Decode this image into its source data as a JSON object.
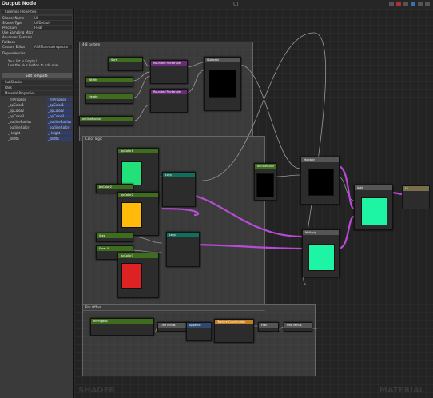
{
  "window": {
    "title": "Output Node",
    "canvas_title": "UI"
  },
  "left_panel": {
    "common_properties_header": "Common Properties",
    "rows": [
      {
        "label": "Shader Name",
        "value": "UI"
      },
      {
        "label": "Shader Type",
        "value": "UI/Default"
      },
      {
        "label": "Precision",
        "value": "Float"
      },
      {
        "label": "Use Sampling Macr",
        "value": ""
      },
      {
        "label": "Advanced Formats",
        "value": ""
      },
      {
        "label": "Fallback",
        "value": ""
      },
      {
        "label": "Custom Editor",
        "value": "ASEMaterialInspector"
      }
    ],
    "dependencies_label": "Dependencies",
    "info_line1": "Your list is Empty!",
    "info_line2": "Use the plus button to add one.",
    "edit_template_label": "Edit Template",
    "sections": [
      "SubShader",
      "Pass",
      "Material Properties"
    ],
    "material_properties": [
      {
        "name": "_fillProgess",
        "value": "_fillProgess"
      },
      {
        "name": "_bpColor1",
        "value": "_bpColor1"
      },
      {
        "name": "_bpColor2",
        "value": "_bpColor2"
      },
      {
        "name": "_bpColor3",
        "value": "_bpColor3"
      },
      {
        "name": "_outlineRadius",
        "value": "_outlineRadius"
      },
      {
        "name": "_outlineColor",
        "value": "_outlineColor"
      },
      {
        "name": "_Height",
        "value": "_Height"
      },
      {
        "name": "_Width",
        "value": "_Width"
      }
    ]
  },
  "groups": [
    {
      "id": "a",
      "title": "4-8 system"
    },
    {
      "id": "b",
      "title": "Color logic"
    },
    {
      "id": "c",
      "title": "Bar Offset"
    }
  ],
  "nodes": {
    "n1": "Sort",
    "n2": "Width",
    "n3": "Height",
    "n4": "outlineRadius",
    "n5": "Rounded Rectangle",
    "n6": "Rounded Rectangle",
    "n7": "Subtract",
    "n8": "bpColor1",
    "n9": "bpColor2",
    "n10": "bpColor3",
    "n11": "Lerp",
    "n12": "Lerp",
    "n13": "Step",
    "n14": "Float 0",
    "n15": "outlineColor",
    "n16": "Multiply",
    "n17": "Multiply",
    "n18": "Add",
    "n19": "fillProgess",
    "n20": "One Minus",
    "n21": "Append",
    "n22": "Texture Coordinates",
    "n23": "Frac",
    "n24": "One Minus",
    "out": "UI"
  },
  "watermarks": {
    "left": "SHADER",
    "right": "MATERIAL"
  },
  "colors": {
    "bp1": "#22e07a",
    "bp2": "#ffba0a",
    "bp3": "#dc2222",
    "result": "#1df5a5",
    "wire": "#b84bd6",
    "wire_white": "#9a9a9a"
  }
}
